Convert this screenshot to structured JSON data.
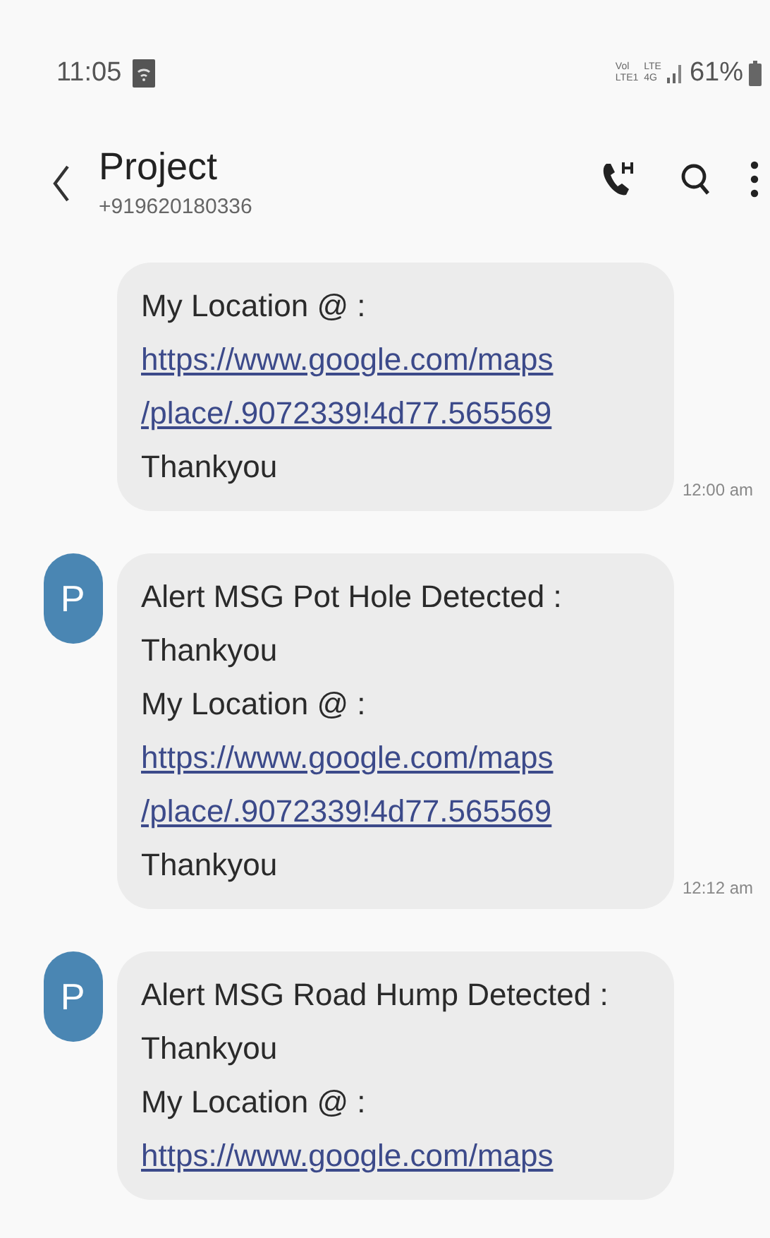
{
  "status_bar": {
    "time": "11:05",
    "network_labels": [
      {
        "top": "Vol",
        "bottom": "LTE1"
      },
      {
        "top": "LTE",
        "bottom": "4G"
      }
    ],
    "battery": "61%"
  },
  "header": {
    "title": "Project",
    "subtitle": "+919620180336"
  },
  "messages": [
    {
      "time": "12:00 am",
      "lines": [
        {
          "kind": "text",
          "text": "My Location @ :"
        },
        {
          "kind": "link",
          "text": "https://www.google.com/maps"
        },
        {
          "kind": "link",
          "text": "/place/.9072339!4d77.565569"
        },
        {
          "kind": "text",
          "text": "Thankyou"
        }
      ]
    },
    {
      "avatar": "P",
      "time": "12:12 am",
      "lines": [
        {
          "kind": "text",
          "text": "Alert MSG Pot Hole Detected :"
        },
        {
          "kind": "text",
          "text": "Thankyou"
        },
        {
          "kind": "text",
          "text": "My Location @ :"
        },
        {
          "kind": "link",
          "text": "https://www.google.com/maps"
        },
        {
          "kind": "link",
          "text": "/place/.9072339!4d77.565569"
        },
        {
          "kind": "text",
          "text": "Thankyou"
        }
      ]
    },
    {
      "avatar": "P",
      "lines": [
        {
          "kind": "text",
          "text": "Alert MSG Road Hump Detected :"
        },
        {
          "kind": "text",
          "text": "Thankyou"
        },
        {
          "kind": "text",
          "text": "My Location @ :"
        },
        {
          "kind": "link",
          "text": "https://www.google.com/maps"
        }
      ]
    }
  ]
}
